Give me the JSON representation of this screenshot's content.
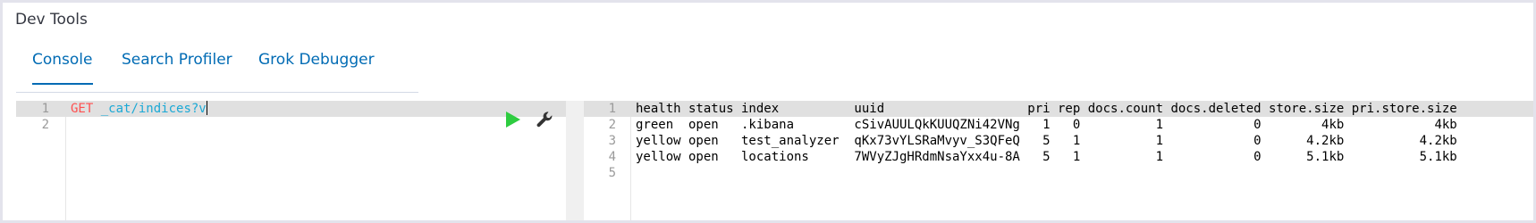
{
  "app": {
    "title": "Dev Tools"
  },
  "tabs": [
    {
      "label": "Console",
      "active": true
    },
    {
      "label": "Search Profiler",
      "active": false
    },
    {
      "label": "Grok Debugger",
      "active": false
    }
  ],
  "editor": {
    "lines": [
      {
        "number": "1",
        "method": "GET",
        "url": "_cat/indices?v"
      },
      {
        "number": "2",
        "method": "",
        "url": ""
      }
    ],
    "actions": {
      "run_icon": "play-icon",
      "settings_icon": "wrench-icon"
    }
  },
  "output": {
    "line_numbers": [
      "1",
      "2",
      "3",
      "4",
      "5"
    ],
    "rows": [
      "health status index          uuid                   pri rep docs.count docs.deleted store.size pri.store.size",
      "green  open   .kibana        cSivAUULQkKUUQZNi42VNg   1   0          1            0        4kb            4kb",
      "yellow open   test_analyzer  qKx73vYLSRaMvyv_S3QFeQ   5   1          1            0      4.2kb          4.2kb",
      "yellow open   locations      7WVyZJgHRdmNsaYxx4u-8A   5   1          1            0      5.1kb          5.1kb",
      ""
    ]
  },
  "colors": {
    "tab_accent": "#006bb4",
    "method": "#ff4f4f",
    "url": "#1ba9d6",
    "run": "#2ecc40"
  }
}
